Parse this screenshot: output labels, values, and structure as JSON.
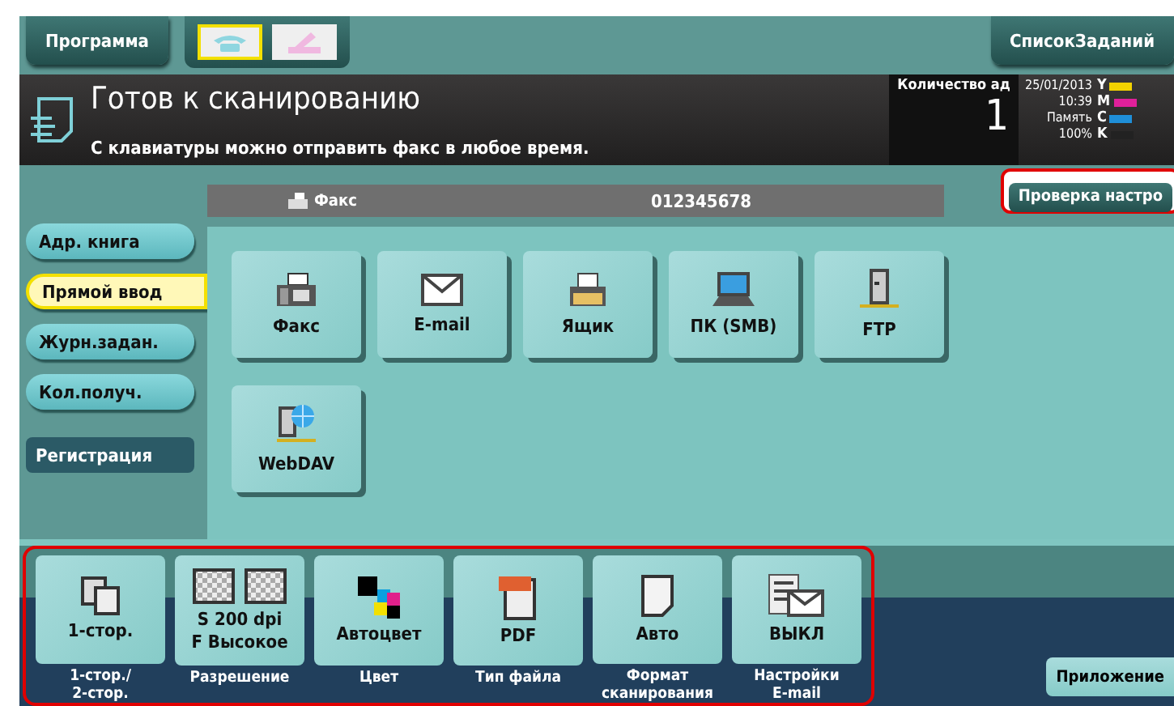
{
  "top_bar": {
    "program_button": "Программа",
    "mode_tabs": [
      {
        "kind": "phone",
        "selected": true
      },
      {
        "kind": "pen",
        "selected": false
      }
    ],
    "job_list_button": "СписокЗаданий"
  },
  "status": {
    "title": "Готов к сканированию",
    "message": "С клавиатуры можно отправить факс в любое время.",
    "count_label": "Количество ад",
    "count": "1",
    "date": "25/01/2013",
    "time": "10:39",
    "memory_label": "Память",
    "memory_value": "100%",
    "toners": [
      {
        "letter": "Y",
        "color": "#f2d200"
      },
      {
        "letter": "M",
        "color": "#e0209a"
      },
      {
        "letter": "C",
        "color": "#1f8fd8"
      },
      {
        "letter": "K",
        "color": "#222222"
      }
    ]
  },
  "check_settings_button": {
    "label": "Проверка настро",
    "highlighted": true
  },
  "destination_bar": {
    "type": "Факс",
    "number": "012345678"
  },
  "sidebar": {
    "items": [
      {
        "label": "Адр. книга",
        "selected": false
      },
      {
        "label": "Прямой ввод",
        "selected": true
      },
      {
        "label": "Журн.задан.",
        "selected": false
      },
      {
        "label": "Кол.получ.",
        "selected": false
      }
    ],
    "register_button": "Регистрация"
  },
  "destinations": [
    {
      "label": "Факс",
      "kind": "fax"
    },
    {
      "label": "E-mail",
      "kind": "mail"
    },
    {
      "label": "Ящик",
      "kind": "box"
    },
    {
      "label": "ПК (SMB)",
      "kind": "pc"
    },
    {
      "label": "FTP",
      "kind": "ftp"
    },
    {
      "label": "WebDAV",
      "kind": "webdav"
    }
  ],
  "functions": {
    "highlighted": true,
    "items": [
      {
        "value": "1-стор.",
        "caption": "1-стор./\n2-стор.",
        "kind": "duplex"
      },
      {
        "value": "S 200 dpi\nF Высокое",
        "caption": "Разрешение",
        "kind": "resolution"
      },
      {
        "value": "Автоцвет",
        "caption": "Цвет",
        "kind": "color"
      },
      {
        "value": "PDF",
        "caption": "Тип файла",
        "kind": "pdf"
      },
      {
        "value": "Авто",
        "caption": "Формат\nсканирования",
        "kind": "page"
      },
      {
        "value": "ВЫКЛ",
        "caption": "Настройки\nE-mail",
        "kind": "emailset"
      }
    ]
  },
  "app_button": "Приложение"
}
